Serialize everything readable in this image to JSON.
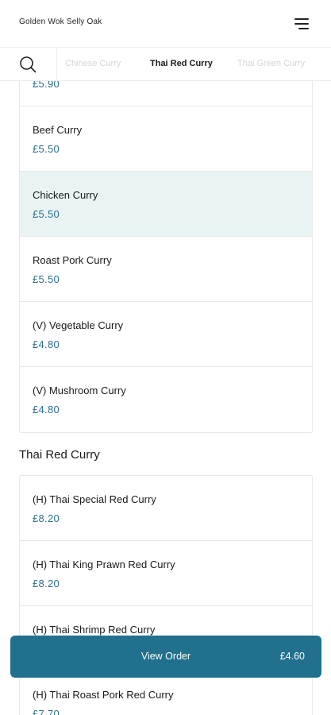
{
  "header": {
    "restaurant_name": "Golden Wok Selly Oak",
    "menu_icon": "hamburger-menu-icon"
  },
  "category_tabs": {
    "search_icon": "search-icon",
    "tabs": [
      {
        "label": "Chinese Curry",
        "active": false
      },
      {
        "label": "Thai Red Curry",
        "active": true
      },
      {
        "label": "Thai Green Curry",
        "active": false
      }
    ]
  },
  "chinese_curry": {
    "items": [
      {
        "name": "",
        "price": "£5.90"
      },
      {
        "name": "Beef Curry",
        "price": "£5.50"
      },
      {
        "name": "Chicken Curry",
        "price": "£5.50",
        "selected": true
      },
      {
        "name": "Roast Pork Curry",
        "price": "£5.50"
      },
      {
        "name": "(V) Vegetable Curry",
        "price": "£4.80"
      },
      {
        "name": "(V) Mushroom Curry",
        "price": "£4.80"
      }
    ]
  },
  "thai_red_curry": {
    "title": "Thai Red Curry",
    "items": [
      {
        "name": "(H) Thai Special Red Curry",
        "price": "£8.20"
      },
      {
        "name": "(H) Thai King Prawn Red Curry",
        "price": "£8.20"
      },
      {
        "name": "(H) Thai Shrimp Red Curry",
        "price": ""
      },
      {
        "name": "(H) Thai Roast Pork Red Curry",
        "price": "£7.70"
      }
    ]
  },
  "order_bar": {
    "label": "View Order",
    "total": "£4.60"
  },
  "colors": {
    "accent": "#20708e",
    "price": "#2a6f8e",
    "selected_row": "#eaf3f4"
  }
}
